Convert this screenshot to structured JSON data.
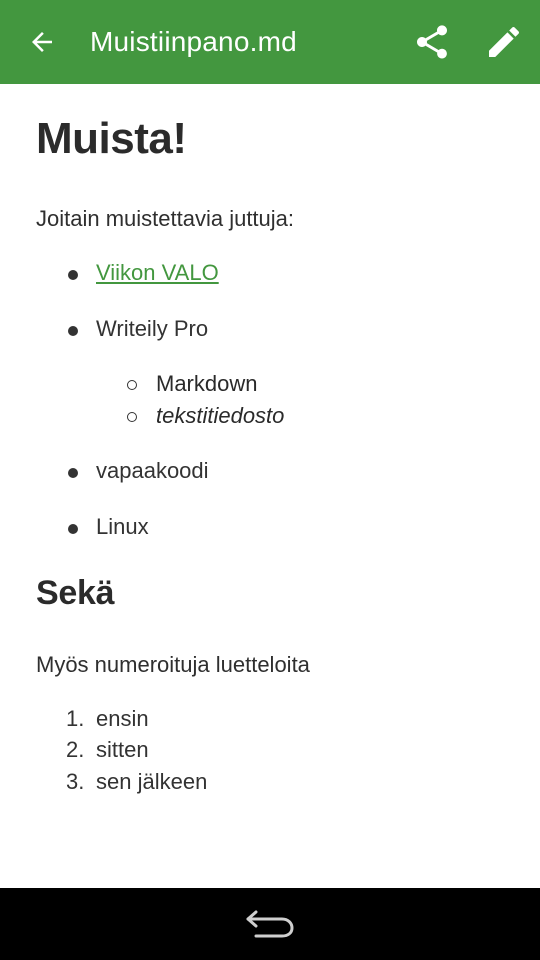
{
  "toolbar": {
    "title": "Muistiinpano.md",
    "color": "#43973f",
    "icons": [
      "arrow-back-icon",
      "share-icon",
      "pencil-icon"
    ]
  },
  "document": {
    "heading1": "Muista!",
    "intro": "Joitain muistettavia juttuja:",
    "bullets": [
      {
        "text": "Viikon VALO",
        "link": true
      },
      {
        "text": "Writeily Pro"
      },
      {
        "text": "vapaakoodi"
      },
      {
        "text": "Linux"
      }
    ],
    "sub_bullets": [
      {
        "text": "Markdown"
      },
      {
        "text": "tekstitiedosto",
        "italic": true
      }
    ],
    "heading2": "Sekä",
    "ordered_intro": "Myös numeroituja luetteloita",
    "ordered_list": [
      {
        "num": "1.",
        "text": "ensin"
      },
      {
        "num": "2.",
        "text": "sitten"
      },
      {
        "num": "3.",
        "text": "sen jälkeen"
      }
    ]
  },
  "navbar": {
    "icons": [
      "back-arrow-icon"
    ]
  }
}
